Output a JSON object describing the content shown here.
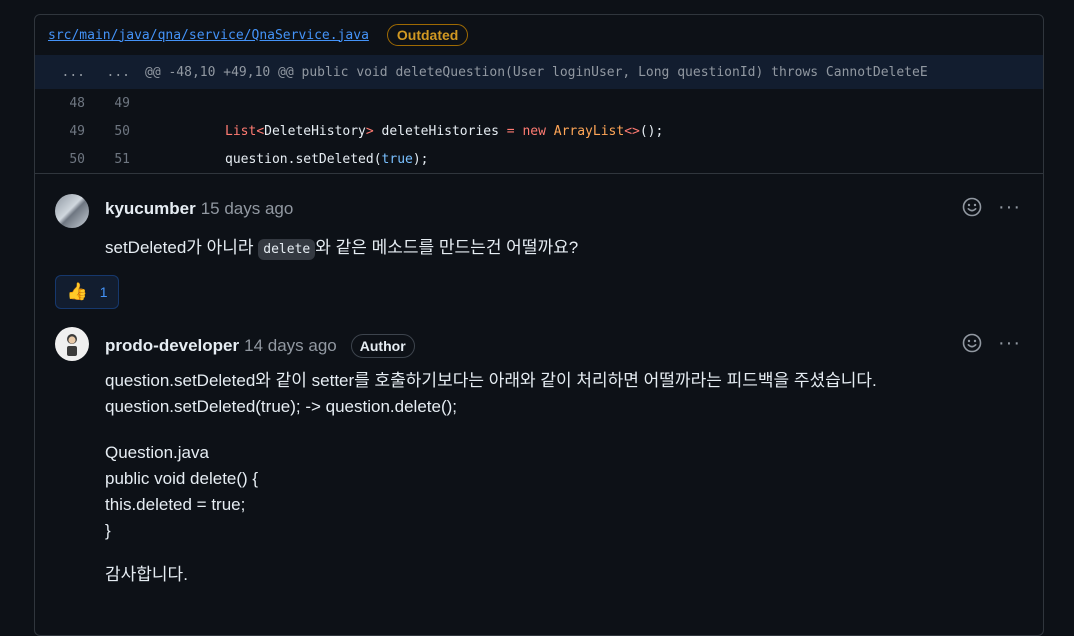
{
  "file": {
    "path": "src/main/java/qna/service/QnaService.java",
    "badge": "Outdated"
  },
  "diff": {
    "hunk": {
      "left": "...",
      "right": "...",
      "text": "@@ -48,10 +49,10 @@ public void deleteQuestion(User loginUser, Long questionId) throws CannotDeleteE"
    },
    "lines": [
      {
        "left": "48",
        "right": "49"
      },
      {
        "left": "49",
        "right": "50"
      },
      {
        "left": "50",
        "right": "51"
      }
    ],
    "code": {
      "line2": {
        "t1": "List",
        "t2": "<",
        "t3": "DeleteHistory",
        "t4": ">",
        "t5": " deleteHistories ",
        "t6": "=",
        "t7": " ",
        "t8": "new",
        "t9": " ",
        "t10": "ArrayList",
        "t11": "<>",
        "t12": "();"
      },
      "line3": {
        "t1": "question.setDeleted(",
        "t2": "true",
        "t3": ");"
      }
    }
  },
  "comments": [
    {
      "author": "kyucumber",
      "time": "15 days ago",
      "body_before": "setDeleted가 아니라 ",
      "body_code": "delete",
      "body_after": "와 같은 메소드를 만드는건 어떨까요?",
      "reaction": {
        "emoji": "👍",
        "count": "1"
      },
      "icons": [
        "smiley-icon",
        "kebab-menu-icon"
      ]
    },
    {
      "author": "prodo-developer",
      "time": "14 days ago",
      "role": "Author",
      "body_lines": [
        "question.setDeleted와 같이 setter를 호출하기보다는 아래와 같이 처리하면 어떨까라는 피드백을 주셨습니다.",
        "question.setDeleted(true); -> question.delete();",
        "Question.java",
        "public void delete() {",
        "this.deleted = true;",
        "}",
        "감사합니다."
      ]
    }
  ],
  "actions": {
    "more": "···"
  }
}
